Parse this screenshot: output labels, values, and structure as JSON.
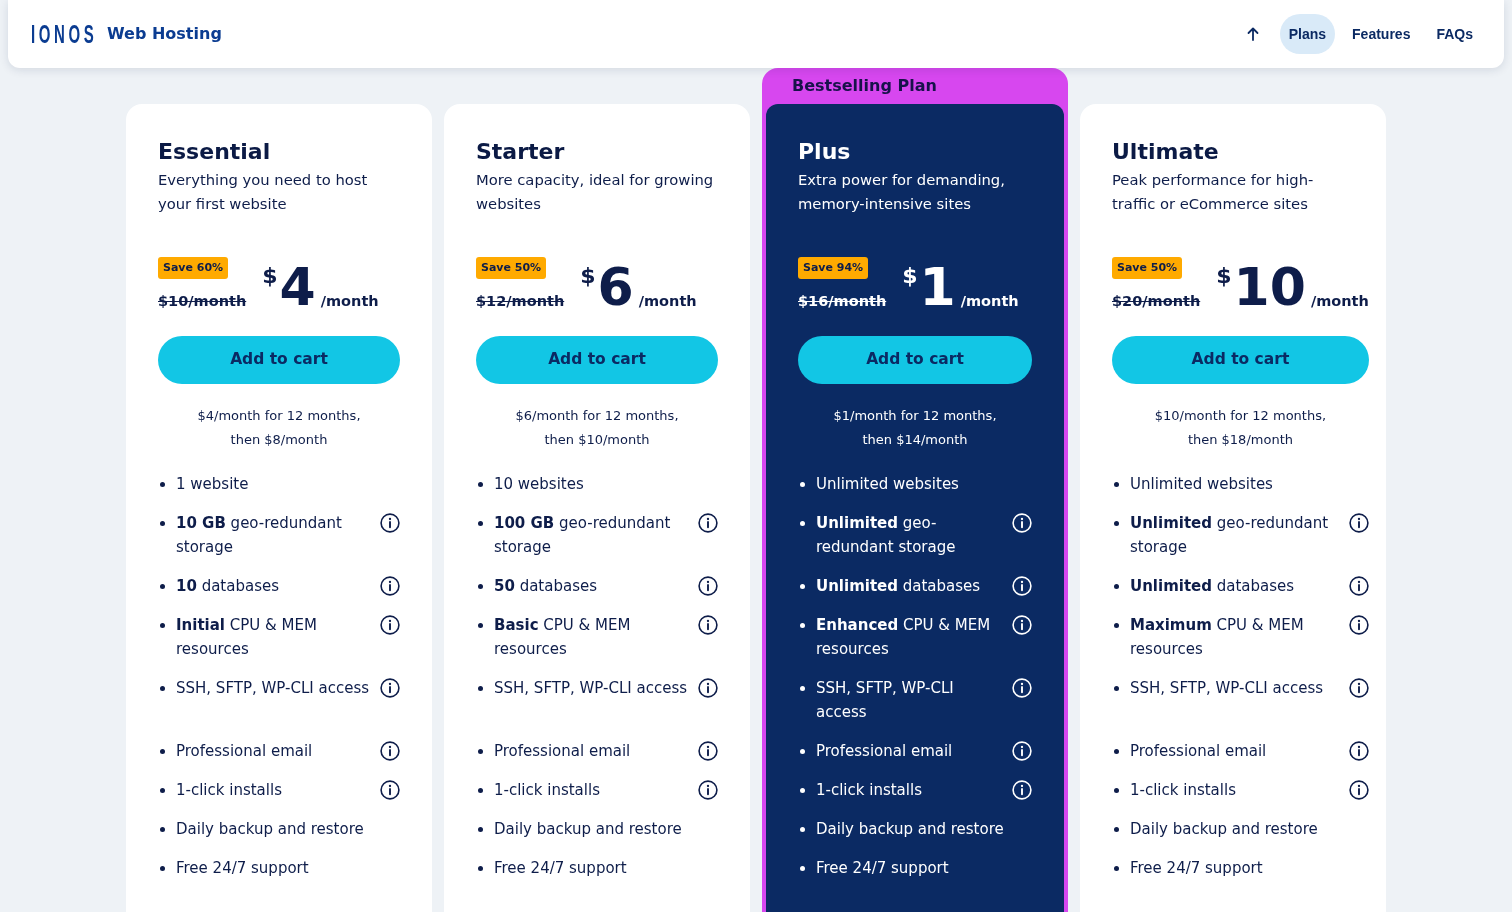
{
  "header": {
    "logo": "IONOS",
    "product": "Web Hosting",
    "nav": [
      {
        "label": "Plans",
        "selected": true
      },
      {
        "label": "Features",
        "selected": false
      },
      {
        "label": "FAQs",
        "selected": false
      }
    ]
  },
  "plans": [
    {
      "name": "Essential",
      "description": "Everything you need to host your first website",
      "highlighted": false,
      "badge": "Save 60%",
      "old_price": "$10/month",
      "currency": "$",
      "amount": "4",
      "period": "/month",
      "button": "Add to cart",
      "note": "$4/month for 12 months, then $8/month",
      "features": [
        {
          "text": "1 website",
          "info": false
        },
        {
          "text": "**10 GB** geo-redundant storage",
          "info": true
        },
        {
          "text": "**10** databases",
          "info": true
        },
        {
          "text": "**Initial** CPU & MEM resources",
          "info": true
        },
        {
          "text": "SSH, SFTP, WP-CLI access",
          "info": true
        },
        {
          "text": "Professional email",
          "info": true
        },
        {
          "text": "1-click installs",
          "info": true
        },
        {
          "text": "Daily backup and restore",
          "info": false
        },
        {
          "text": "Free 24/7 support",
          "info": false
        }
      ]
    },
    {
      "name": "Starter",
      "description": "More capacity, ideal for growing websites",
      "highlighted": false,
      "badge": "Save 50%",
      "old_price": "$12/month",
      "currency": "$",
      "amount": "6",
      "period": "/month",
      "button": "Add to cart",
      "note": "$6/month for 12 months, then $10/month",
      "features": [
        {
          "text": "10 websites",
          "info": false
        },
        {
          "text": "**100 GB** geo-redundant storage",
          "info": true
        },
        {
          "text": "**50** databases",
          "info": true
        },
        {
          "text": "**Basic** CPU & MEM resources",
          "info": true
        },
        {
          "text": "SSH, SFTP, WP-CLI access",
          "info": true
        },
        {
          "text": "Professional email",
          "info": true
        },
        {
          "text": "1-click installs",
          "info": true
        },
        {
          "text": "Daily backup and restore",
          "info": false
        },
        {
          "text": "Free 24/7 support",
          "info": false
        }
      ]
    },
    {
      "name": "Plus",
      "ribbon": "Bestselling Plan",
      "description": "Extra power for demanding, memory-intensive sites",
      "highlighted": true,
      "badge": "Save 94%",
      "old_price": "$16/month",
      "currency": "$",
      "amount": "1",
      "period": "/month",
      "button": "Add to cart",
      "note": "$1/month for 12 months, then $14/month",
      "features": [
        {
          "text": "Unlimited websites",
          "info": false
        },
        {
          "text": "**Unlimited** geo-redundant storage",
          "info": true
        },
        {
          "text": "**Unlimited** databases",
          "info": true
        },
        {
          "text": "**Enhanced** CPU & MEM resources",
          "info": true
        },
        {
          "text": "SSH, SFTP, WP-CLI access",
          "info": true
        },
        {
          "text": "Professional email",
          "info": true
        },
        {
          "text": "1-click installs",
          "info": true
        },
        {
          "text": "Daily backup and restore",
          "info": false
        },
        {
          "text": "Free 24/7 support",
          "info": false
        }
      ]
    },
    {
      "name": "Ultimate",
      "description": "Peak performance for high-traffic or eCommerce sites",
      "highlighted": false,
      "badge": "Save 50%",
      "old_price": "$20/month",
      "currency": "$",
      "amount": "10",
      "period": "/month",
      "button": "Add to cart",
      "note": "$10/month for 12 months, then $18/month",
      "features": [
        {
          "text": "Unlimited websites",
          "info": false
        },
        {
          "text": "**Unlimited** geo-redundant storage",
          "info": true
        },
        {
          "text": "**Unlimited** databases",
          "info": true
        },
        {
          "text": "**Maximum** CPU & MEM resources",
          "info": true
        },
        {
          "text": "SSH, SFTP, WP-CLI access",
          "info": true
        },
        {
          "text": "Professional email",
          "info": true
        },
        {
          "text": "1-click installs",
          "info": true
        },
        {
          "text": "Daily backup and restore",
          "info": false
        },
        {
          "text": "Free 24/7 support",
          "info": false
        }
      ]
    }
  ]
}
